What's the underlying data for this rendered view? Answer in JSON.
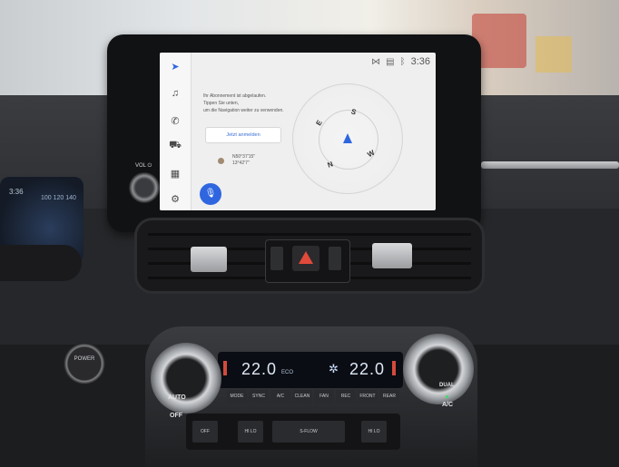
{
  "head_unit": {
    "status": {
      "time": "3:36",
      "icons": [
        "signal-icon",
        "wifi-icon",
        "bluetooth-icon"
      ]
    },
    "sidebar": {
      "items": [
        {
          "name": "navigation",
          "icon": "navigation-arrow-icon",
          "glyph": "➤",
          "active": true
        },
        {
          "name": "music",
          "icon": "music-note-icon",
          "glyph": "♫"
        },
        {
          "name": "phone",
          "icon": "phone-icon",
          "glyph": "✆"
        },
        {
          "name": "vehicle",
          "icon": "car-icon",
          "glyph": "⛟"
        },
        {
          "name": "apps",
          "icon": "grid-icon",
          "glyph": "▦"
        },
        {
          "name": "settings",
          "icon": "gear-icon",
          "glyph": "⚙"
        }
      ]
    },
    "message_lines": [
      "Ihr Abonnement ist abgelaufen.",
      "Tippen Sie unten,",
      "um die Navigation weiter zu verwenden."
    ],
    "login_button": "Jetzt anmelden",
    "coordinates": {
      "lat": "N50°37'15\"",
      "lon": "13°42'7\""
    },
    "compass": {
      "N": "N",
      "S": "S",
      "E": "E",
      "W": "W"
    },
    "mic_icon": "microphone-icon",
    "volume_label": "VOL ⏻"
  },
  "climate": {
    "temp_left": "22.0",
    "temp_right": "22.0",
    "eco_label": "ECO",
    "knob_left": {
      "top": "AUTO",
      "bottom": "OFF"
    },
    "knob_right": {
      "top": "DUAL",
      "bottom": "A/C"
    },
    "row_buttons": [
      "MODE",
      "SYNC",
      "A/C",
      "CLEAN",
      "FAN",
      "REC",
      "FRONT",
      "REAR"
    ],
    "lower_buttons": [
      "OFF",
      "HI LO",
      "S-FLOW",
      "HI LO"
    ]
  },
  "cluster": {
    "time": "3:36",
    "speed_scale": "100  120  140"
  },
  "power_button": "POWER"
}
